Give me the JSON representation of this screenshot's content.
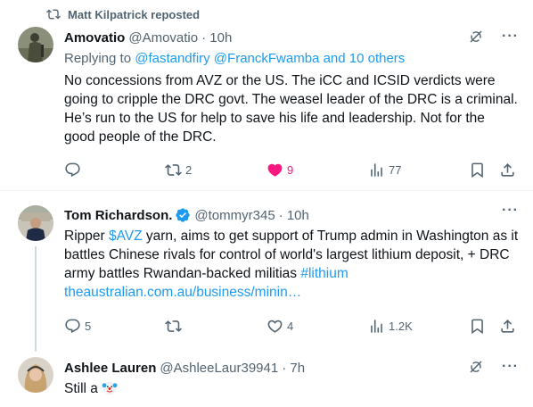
{
  "repost_banner": {
    "text": "Matt Kilpatrick reposted"
  },
  "posts": [
    {
      "name": "Amovatio",
      "handle": "@Amovatio",
      "time": "· 10h",
      "replying_prefix": "Replying to ",
      "replying_targets": "@fastandfiry @FranckFwamba and 10 others",
      "text": "No concessions from AVZ or the US. The iCC and ICSID verdicts were going to cripple the DRC govt. The weasel leader of the DRC is a criminal. He’s run to the US for help to save his life and leadership. Not for the good people of the DRC.",
      "replies": "",
      "reposts": "2",
      "likes": "9",
      "views": "77"
    },
    {
      "name": "Tom Richardson.",
      "handle": "@tommyr345",
      "time": "· 10h",
      "text_part1": "Ripper ",
      "cashtag": "$AVZ",
      "text_part2": " yarn, aims to get support of Trump admin in Washington as it battles Chinese rivals for control of world's largest lithium deposit, + DRC army battles Rwandan-backed militias ",
      "hashtag": "#lithium",
      "url": "theaustralian.com.au/business/minin…",
      "replies": "5",
      "reposts": "",
      "likes": "4",
      "views": "1.2K"
    },
    {
      "name": "Ashlee Lauren",
      "handle": "@AshleeLaur39941",
      "time": "· 7h",
      "text": "Still a"
    }
  ],
  "icons": {
    "repost": "repost-icon",
    "reply": "reply-icon",
    "like": "heart-icon",
    "views": "views-icon",
    "bookmark": "bookmark-icon",
    "share": "share-icon",
    "more": "more-icon",
    "grok": "grok-icon",
    "verified": "verified-badge-icon",
    "emoji": "clown-face-icon"
  },
  "colors": {
    "accent": "#1d9bf0",
    "like": "#f91880",
    "secondary_text": "#536471"
  }
}
